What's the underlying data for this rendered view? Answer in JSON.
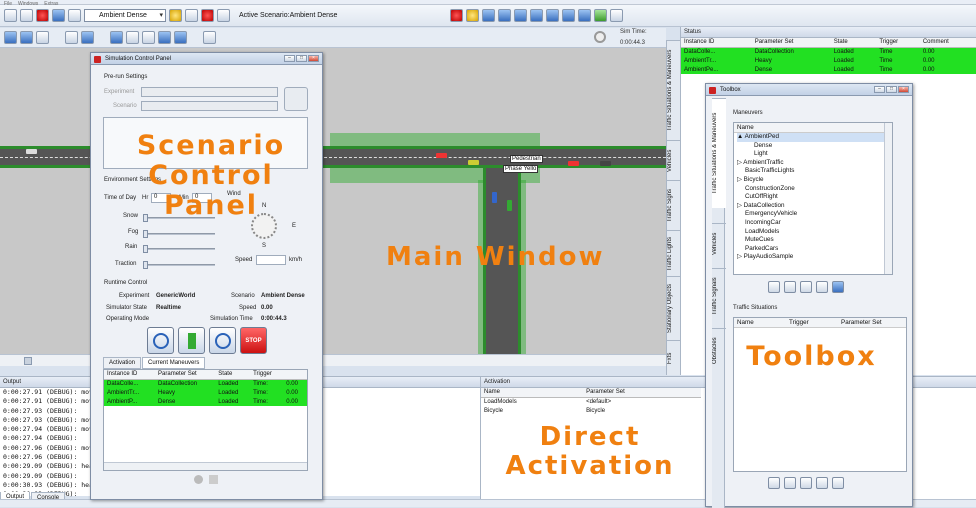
{
  "app": {
    "menu": [
      "File",
      "Windows",
      "Extras"
    ],
    "scenario_select": "Ambient Dense",
    "active_scenario": "Active Scenario:Ambient Dense",
    "sim_time_label": "Sim Time:",
    "sim_time_value": "0:00:44.3"
  },
  "vertical_tabs": [
    "Traffic Situations & Maneuvers",
    "Vehicles",
    "Traffic Signs",
    "Traffic Lights",
    "Stationary Objects",
    "Fxts"
  ],
  "status": {
    "title": "Status",
    "columns": [
      "Instance ID",
      "Parameter Set",
      "State",
      "Trigger",
      "Comment"
    ],
    "rows": [
      {
        "id": "DataColle...",
        "set": "DataCollection",
        "state": "Loaded",
        "trigger": "Time",
        "comment": "0.00"
      },
      {
        "id": "AmbientTr...",
        "set": "Heavy",
        "state": "Loaded",
        "trigger": "Time",
        "comment": "0.00"
      },
      {
        "id": "AmbientPe...",
        "set": "Dense",
        "state": "Loaded",
        "trigger": "Time",
        "comment": "0.00"
      }
    ]
  },
  "output": {
    "title": "Output",
    "lines": [
      "0:00:27.91 (DEBUG): movePe",
      "0:00:27.91 (DEBUG): movePe",
      "0:00:27.93 (DEBUG):",
      "0:00:27.93 (DEBUG): movePe",
      "0:00:27.94 (DEBUG): movePe",
      "0:00:27.94 (DEBUG):",
      "0:00:27.96 (DEBUG): movePe",
      "0:00:27.96 (DEBUG):",
      "0:00:29.09 (DEBUG): heading",
      "0:00:29.09 (DEBUG):",
      "0:00:30.93 (DEBUG): heading",
      "0:00:30.93 (DEBUG):"
    ],
    "tabs": [
      "Output",
      "Console"
    ]
  },
  "activation": {
    "title": "Activation",
    "columns": [
      "Name",
      "Parameter Set"
    ],
    "rows": [
      {
        "name": "LoadModels",
        "set": "<default>"
      },
      {
        "name": "Bicycle",
        "set": "Bicycle"
      }
    ]
  },
  "scp": {
    "title": "Simulation Control Panel",
    "prerun": "Pre-run Settings",
    "experiment_label": "Experiment",
    "scenario_label": "Scenario",
    "env": "Environment Settings",
    "timeofday": "Time of Day",
    "hr": "Hr",
    "hr_val": "0",
    "min": "Min",
    "min_val": "0",
    "wind": "Wind",
    "snow": "Snow",
    "fog": "Fog",
    "rain": "Rain",
    "traction": "Traction",
    "speed": "Speed",
    "kmh": "km/h",
    "compass_n": "N",
    "compass_e": "E",
    "compass_s": "S",
    "runtime": "Runtime Control",
    "experiment": "Experiment",
    "experiment_val": "GenericWorld",
    "scenario": "Scenario",
    "scenario_val": "Ambient Dense",
    "simstate": "Simulator State",
    "simstate_val": "Realtime",
    "speed2": "Speed",
    "speed2_val": "0.00",
    "opmode": "Operating Mode",
    "simtime": "Simulation Time",
    "simtime_val": "0:00:44.3",
    "stop": "STOP",
    "tab_activation": "Activation",
    "tab_current": "Current Maneuvers",
    "columns": [
      "Instance ID",
      "Parameter Set",
      "State",
      "Trigger"
    ],
    "rows": [
      {
        "id": "DataColle...",
        "set": "DataCollection",
        "state": "Loaded",
        "trigger": "Time:",
        "val": "0.00"
      },
      {
        "id": "AmbientTr...",
        "set": "Heavy",
        "state": "Loaded",
        "trigger": "Time:",
        "val": "0.00"
      },
      {
        "id": "AmbientP...",
        "set": "Dense",
        "state": "Loaded",
        "trigger": "Time:",
        "val": "0.00"
      }
    ]
  },
  "toolbox": {
    "title": "Toolbox",
    "maneuvers": "Maneuvers",
    "name_col": "Name",
    "items": [
      "AmbientPed",
      "Dense",
      "Light",
      "AmbientTraffic",
      "BasicTrafficLights",
      "Bicycle",
      "ConstructionZone",
      "CutOffRight",
      "DataCollection",
      "EmergencyVehicle",
      "IncomingCar",
      "LoadModels",
      "MuteCues",
      "ParkedCars",
      "PlayAudioSample"
    ],
    "tabs": [
      "Traffic Situations & Maneuvers",
      "Vehicles",
      "Traffic Signals",
      "Obstacles"
    ],
    "traffic_situations": "Traffic Situations",
    "ts_columns": [
      "Name",
      "Trigger",
      "Parameter Set"
    ]
  },
  "sim_labels": {
    "label1": "Pedestrian",
    "label2": "Phase Yello"
  },
  "annotations": {
    "scp": "Scenario Control Panel",
    "main": "Main Window",
    "toolbox": "Toolbox",
    "direct": "Direct Activation"
  },
  "colors": {
    "accent_orange": "#f08010",
    "loaded_green": "#22e022"
  }
}
